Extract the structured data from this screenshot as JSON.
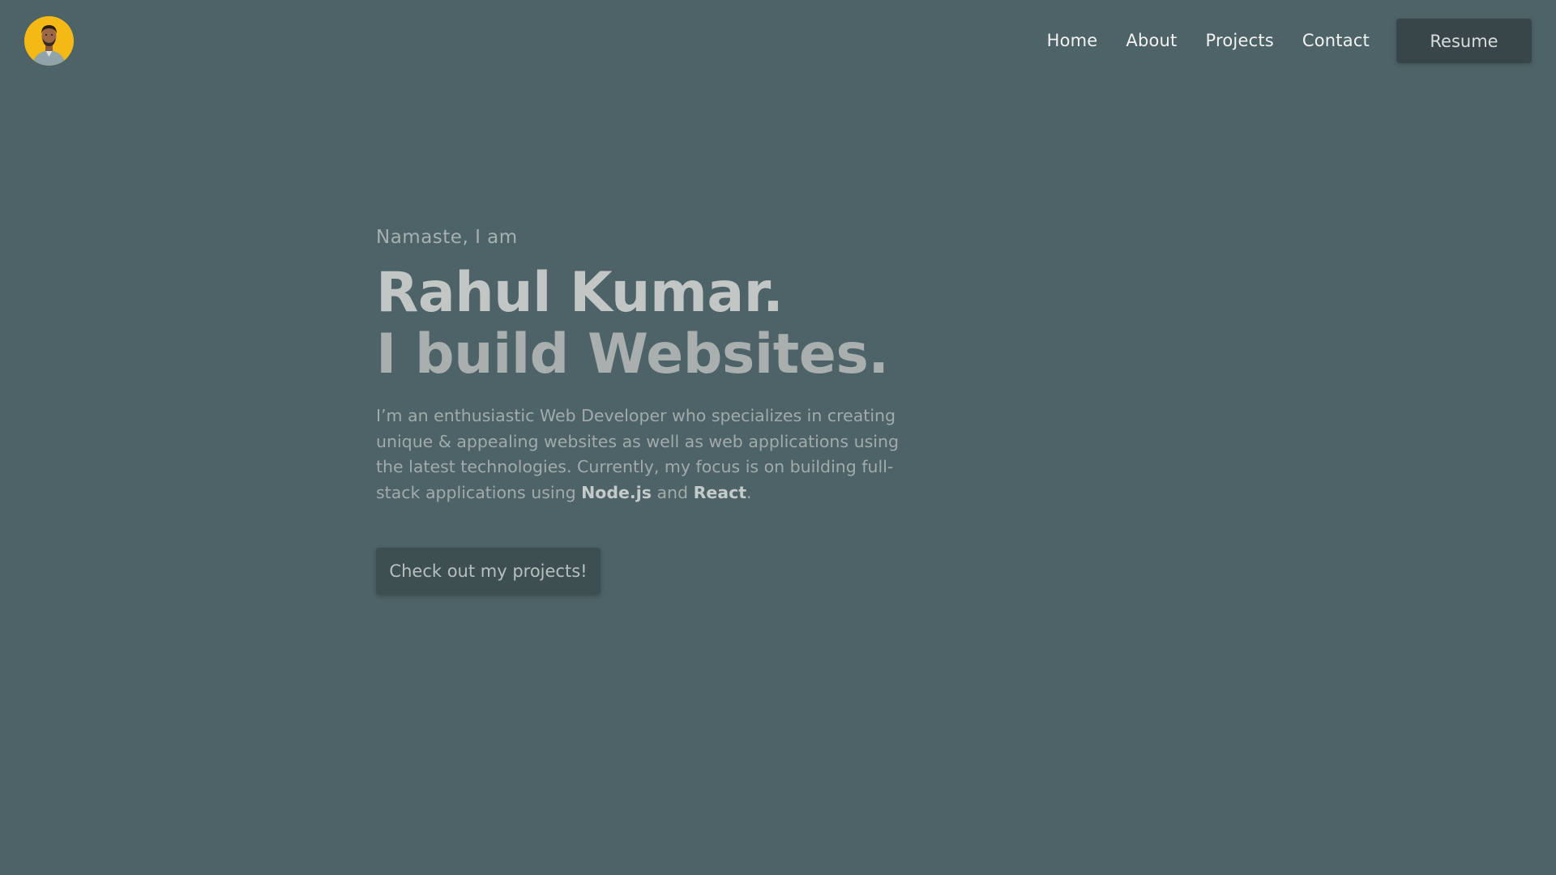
{
  "header": {
    "avatar_icon": "profile-avatar",
    "nav": {
      "home": "Home",
      "about": "About",
      "projects": "Projects",
      "contact": "Contact"
    },
    "resume_label": "Resume"
  },
  "hero": {
    "greeting": "Namaste, I am",
    "name": "Rahul Kumar.",
    "tagline": "I build Websites.",
    "bio_part1": "I’m an enthusiastic Web Developer who specializes in creating unique & appealing websites as well as web applications using the latest technologies. Currently, my focus is on building full-stack applications using ",
    "bio_tech1": "Node.js",
    "bio_and": " and ",
    "bio_tech2": "React",
    "bio_end": ".",
    "cta_label": "Check out my projects!"
  },
  "colors": {
    "background": "#4e6367",
    "avatar_bg": "#f5b915",
    "button_bg": "#394649",
    "nav_text": "#f1f3f3"
  }
}
